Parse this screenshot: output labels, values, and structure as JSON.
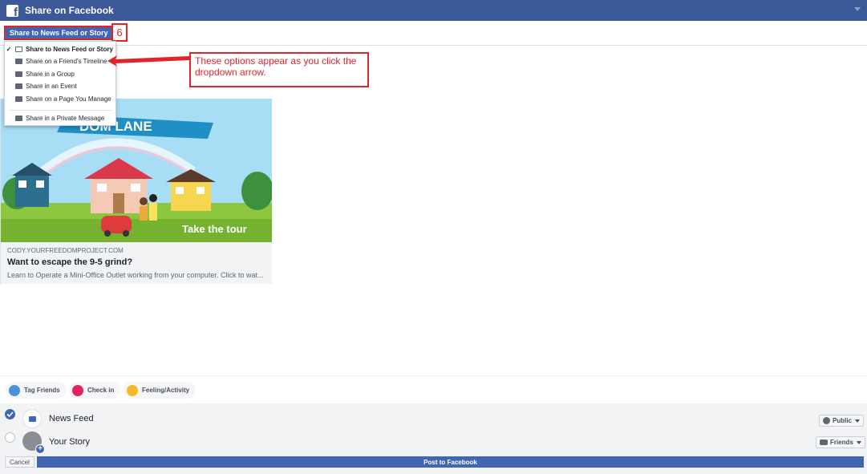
{
  "window": {
    "title": "Share on Facebook"
  },
  "share_target": {
    "label": "Share to News Feed or Story",
    "step_number": "6"
  },
  "dropdown": {
    "items": [
      {
        "label": "Share to News Feed or Story",
        "icon": "compose-icon",
        "checked": true
      },
      {
        "label": "Share on a Friend's Timeline",
        "icon": "friends-icon",
        "checked": false
      },
      {
        "label": "Share in a Group",
        "icon": "group-icon",
        "checked": false
      },
      {
        "label": "Share in an Event",
        "icon": "calendar-icon",
        "checked": false
      },
      {
        "label": "Share on a Page You Manage",
        "icon": "flag-icon",
        "checked": false
      },
      {
        "label": "Share in a Private Message",
        "icon": "message-icon",
        "checked": false
      }
    ]
  },
  "annotation": {
    "text": "These options appear as you click the dropdown arrow."
  },
  "preview": {
    "banner_text": "DOM LANE",
    "tour_text": "Take the tour",
    "domain": "CODY.YOURFREEDOMPROJECT.COM",
    "title": "Want to escape the 9-5 grind?",
    "description": "Learn to Operate a Mini-Office Outlet working from your computer. Click to wat..."
  },
  "actions": {
    "tag_friends": "Tag Friends",
    "check_in": "Check in",
    "feeling": "Feeling/Activity"
  },
  "destinations": {
    "news_feed": {
      "label": "News Feed",
      "privacy": "Public",
      "selected": true
    },
    "your_story": {
      "label": "Your Story",
      "privacy": "Friends",
      "selected": false
    }
  },
  "footer": {
    "cancel": "Cancel",
    "post": "Post to Facebook"
  },
  "colors": {
    "brand": "#3b5998",
    "button": "#4267b2",
    "annotation": "#e0242b"
  }
}
